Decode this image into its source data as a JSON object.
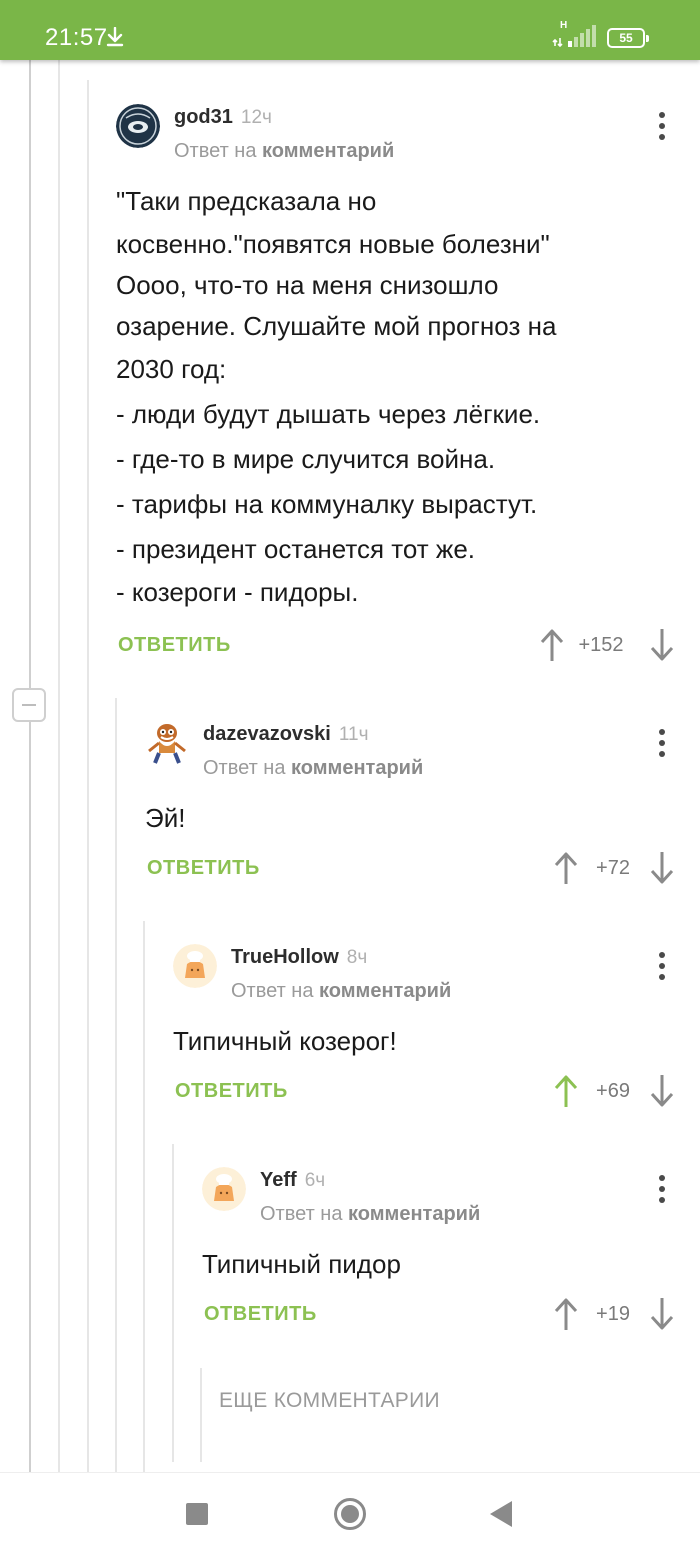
{
  "status_bar": {
    "time": "21:57",
    "network": "H",
    "battery": "55",
    "icons": [
      "download-icon",
      "signal-icon",
      "battery-icon"
    ]
  },
  "comments": [
    {
      "author": "god31",
      "time": "12ч",
      "reply_prefix": "Ответ на",
      "reply_link": "комментарий",
      "lines": [
        "\"Таки предсказала но",
        "косвенно.\"появятся новые болезни\"",
        "Оооо, что-то на меня снизошло",
        "озарение. Слушайте мой прогноз на",
        "2030 год:",
        "- люди будут дышать через лёгкие.",
        "- где-то в мире случится война.",
        "- тарифы на коммуналку вырастут.",
        "- президент останется тот же.",
        "- козероги - пидоры."
      ],
      "reply_label": "ОТВЕТИТЬ",
      "rating": "+152",
      "upvoted": false
    },
    {
      "author": "dazevazovski",
      "time": "11ч",
      "reply_prefix": "Ответ на",
      "reply_link": "комментарий",
      "lines": [
        "Эй!"
      ],
      "reply_label": "ОТВЕТИТЬ",
      "rating": "+72",
      "upvoted": false
    },
    {
      "author": "TrueHollow",
      "time": "8ч",
      "reply_prefix": "Ответ на",
      "reply_link": "комментарий",
      "lines": [
        "Типичный козерог!"
      ],
      "reply_label": "ОТВЕТИТЬ",
      "rating": "+69",
      "upvoted": true
    },
    {
      "author": "Yeff",
      "time": "6ч",
      "reply_prefix": "Ответ на",
      "reply_link": "комментарий",
      "lines": [
        "Типичный пидор"
      ],
      "reply_label": "ОТВЕТИТЬ",
      "rating": "+19",
      "upvoted": false
    }
  ],
  "more_comments_label": "ЕЩЕ КОММЕНТАРИИ",
  "colors": {
    "status_bar": "#7ab648",
    "accent": "#8cc152",
    "arrow_neutral": "#8a8a8a",
    "arrow_active": "#8cc152"
  }
}
